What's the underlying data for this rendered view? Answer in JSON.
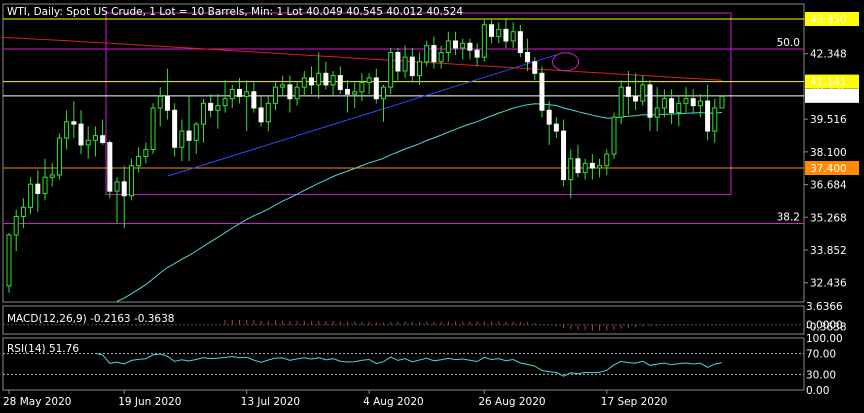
{
  "chart_data": {
    "type": "candlestick",
    "title": "WTI, Daily:  Spot US Crude, 1 Lot = 10 Barrels, Min: 1 Lot  40.049 40.545 40.012 40.524",
    "ylim": [
      31.6,
      44.5
    ],
    "y_ticks": [
      "43.850",
      "42.348",
      "40.932",
      "39.516",
      "38.100",
      "36.684",
      "35.268",
      "33.852",
      "32.436"
    ],
    "x_ticks": [
      "28 May 2020",
      "19 Jun 2020",
      "13 Jul 2020",
      "4 Aug 2020",
      "26 Aug 2020",
      "17 Sep 2020"
    ],
    "price_levels": [
      {
        "value": "43.850",
        "color": "#ffff00",
        "label_bg": "#ffff00",
        "label_fg": "#000000"
      },
      {
        "value": "41.141",
        "color": "#ffff00",
        "label_bg": "#ffff00",
        "label_fg": "#000000"
      },
      {
        "value": "40.524",
        "color": "#ffffff",
        "label_bg": "#ffffff",
        "label_fg": "#000000"
      },
      {
        "value": "37.400",
        "color": "#ff8c00",
        "label_bg": "#ff8c00",
        "label_fg": "#000000"
      }
    ],
    "fibo": [
      {
        "label": "50.0",
        "value": 42.55
      },
      {
        "label": "38.2",
        "value": 35.0
      }
    ],
    "candles": [
      [
        32.3,
        34.6,
        32.0,
        34.5
      ],
      [
        34.5,
        35.6,
        33.8,
        35.3
      ],
      [
        35.3,
        36.1,
        34.8,
        35.7
      ],
      [
        35.7,
        37.0,
        35.4,
        36.7
      ],
      [
        36.7,
        37.3,
        35.5,
        36.3
      ],
      [
        36.3,
        37.8,
        36.0,
        37.0
      ],
      [
        37.0,
        37.6,
        36.6,
        37.1
      ],
      [
        37.1,
        38.9,
        36.9,
        38.7
      ],
      [
        38.7,
        39.9,
        38.2,
        39.4
      ],
      [
        39.4,
        40.3,
        38.7,
        39.3
      ],
      [
        39.3,
        39.9,
        38.0,
        38.4
      ],
      [
        38.4,
        39.2,
        37.8,
        38.6
      ],
      [
        38.6,
        39.2,
        37.9,
        38.8
      ],
      [
        38.8,
        39.5,
        38.4,
        38.5
      ],
      [
        38.5,
        38.6,
        36.1,
        36.4
      ],
      [
        36.4,
        37.0,
        35.0,
        36.8
      ],
      [
        36.8,
        37.5,
        34.8,
        36.2
      ],
      [
        36.2,
        37.8,
        36.0,
        37.5
      ],
      [
        37.5,
        38.3,
        37.2,
        37.9
      ],
      [
        37.9,
        38.5,
        37.6,
        38.2
      ],
      [
        38.2,
        40.2,
        38.0,
        40.0
      ],
      [
        40.0,
        40.9,
        39.2,
        40.5
      ],
      [
        40.5,
        41.7,
        39.5,
        39.9
      ],
      [
        39.9,
        40.2,
        37.9,
        38.3
      ],
      [
        38.3,
        39.5,
        37.7,
        39.0
      ],
      [
        39.0,
        40.5,
        37.7,
        38.6
      ],
      [
        38.6,
        39.4,
        38.0,
        39.3
      ],
      [
        39.3,
        40.4,
        38.5,
        40.2
      ],
      [
        40.2,
        40.6,
        39.6,
        39.9
      ],
      [
        39.9,
        40.6,
        39.1,
        40.1
      ],
      [
        40.1,
        41.2,
        39.8,
        40.4
      ],
      [
        40.4,
        41.0,
        40.0,
        40.8
      ],
      [
        40.8,
        41.3,
        40.2,
        40.5
      ],
      [
        40.5,
        41.2,
        39.0,
        40.7
      ],
      [
        40.7,
        41.1,
        39.8,
        40.0
      ],
      [
        40.0,
        40.5,
        39.2,
        39.4
      ],
      [
        39.4,
        40.5,
        39.0,
        40.2
      ],
      [
        40.2,
        41.1,
        39.9,
        40.9
      ],
      [
        40.9,
        41.4,
        40.5,
        41.0
      ],
      [
        41.0,
        41.4,
        39.8,
        40.4
      ],
      [
        40.4,
        41.1,
        40.1,
        40.9
      ],
      [
        40.9,
        41.6,
        40.5,
        41.3
      ],
      [
        41.3,
        41.8,
        40.6,
        41.0
      ],
      [
        41.0,
        42.4,
        40.4,
        41.5
      ],
      [
        41.5,
        42.0,
        40.8,
        41.0
      ],
      [
        41.0,
        41.6,
        40.5,
        41.4
      ],
      [
        41.4,
        41.8,
        40.6,
        40.8
      ],
      [
        40.8,
        41.2,
        39.8,
        40.6
      ],
      [
        40.6,
        41.1,
        40.0,
        40.7
      ],
      [
        40.7,
        41.5,
        40.3,
        41.1
      ],
      [
        41.1,
        41.5,
        40.6,
        41.3
      ],
      [
        41.3,
        41.7,
        40.2,
        40.4
      ],
      [
        40.4,
        41.0,
        39.4,
        40.9
      ],
      [
        40.9,
        42.6,
        40.6,
        42.4
      ],
      [
        42.4,
        42.6,
        41.2,
        41.6
      ],
      [
        41.6,
        42.7,
        41.3,
        42.2
      ],
      [
        42.2,
        42.6,
        41.1,
        41.4
      ],
      [
        41.4,
        42.4,
        41.0,
        42.0
      ],
      [
        42.0,
        42.9,
        41.8,
        42.7
      ],
      [
        42.7,
        43.1,
        41.7,
        42.0
      ],
      [
        42.0,
        42.7,
        41.7,
        42.4
      ],
      [
        42.4,
        43.3,
        42.0,
        42.9
      ],
      [
        42.9,
        43.3,
        42.3,
        42.6
      ],
      [
        42.6,
        43.0,
        42.1,
        42.8
      ],
      [
        42.8,
        43.0,
        42.1,
        42.5
      ],
      [
        42.5,
        42.8,
        41.8,
        42.2
      ],
      [
        42.2,
        43.8,
        42.0,
        43.6
      ],
      [
        43.6,
        43.8,
        42.8,
        43.1
      ],
      [
        43.1,
        43.7,
        42.8,
        43.4
      ],
      [
        43.4,
        43.9,
        42.6,
        42.9
      ],
      [
        42.9,
        43.7,
        42.6,
        43.3
      ],
      [
        43.3,
        43.6,
        42.2,
        42.4
      ],
      [
        42.4,
        43.0,
        41.6,
        42.0
      ],
      [
        42.0,
        42.2,
        41.2,
        41.5
      ],
      [
        41.5,
        41.8,
        39.6,
        39.9
      ],
      [
        39.9,
        40.3,
        38.4,
        39.3
      ],
      [
        39.3,
        39.6,
        38.7,
        39.0
      ],
      [
        39.0,
        39.5,
        36.6,
        36.9
      ],
      [
        36.9,
        38.2,
        36.1,
        37.8
      ],
      [
        37.8,
        38.4,
        37.0,
        37.2
      ],
      [
        37.2,
        37.8,
        36.9,
        37.6
      ],
      [
        37.6,
        38.0,
        36.9,
        37.4
      ],
      [
        37.4,
        37.8,
        37.0,
        37.5
      ],
      [
        37.5,
        38.2,
        37.1,
        38.0
      ],
      [
        38.0,
        39.8,
        37.8,
        39.6
      ],
      [
        39.6,
        41.2,
        39.3,
        40.9
      ],
      [
        40.9,
        41.6,
        39.7,
        40.5
      ],
      [
        40.5,
        41.5,
        39.9,
        40.3
      ],
      [
        40.3,
        41.4,
        40.1,
        41.0
      ],
      [
        41.0,
        41.2,
        39.0,
        39.6
      ],
      [
        39.6,
        40.9,
        39.0,
        40.0
      ],
      [
        40.0,
        40.8,
        39.6,
        40.4
      ],
      [
        40.4,
        40.8,
        39.3,
        39.8
      ],
      [
        39.8,
        40.5,
        39.2,
        40.2
      ],
      [
        40.2,
        40.9,
        39.8,
        40.4
      ],
      [
        40.4,
        40.8,
        39.8,
        40.1
      ],
      [
        40.1,
        40.6,
        39.6,
        40.3
      ],
      [
        40.3,
        41.0,
        38.6,
        39.0
      ],
      [
        39.0,
        40.4,
        38.5,
        40.0
      ],
      [
        40.0,
        40.5,
        40.0,
        40.5
      ]
    ],
    "ma_red": {
      "name": "",
      "color": "#d42020",
      "from": 43.05,
      "to": 41.2
    },
    "ma_cyan": {
      "name": "",
      "color": "#4fd6d6"
    },
    "macd": {
      "label": "MACD(12,26,9) -0.2163 -0.3638",
      "ticks": [
        "3.6366",
        "0.0000",
        "-0.3638"
      ],
      "range": [
        -1.8,
        3.6366
      ]
    },
    "rsi": {
      "label": "RSI(14) 51.76",
      "ticks": [
        "100.00",
        "70.00",
        "30.00",
        "0.00"
      ],
      "levels": [
        70,
        30
      ],
      "value": 51.76
    }
  }
}
